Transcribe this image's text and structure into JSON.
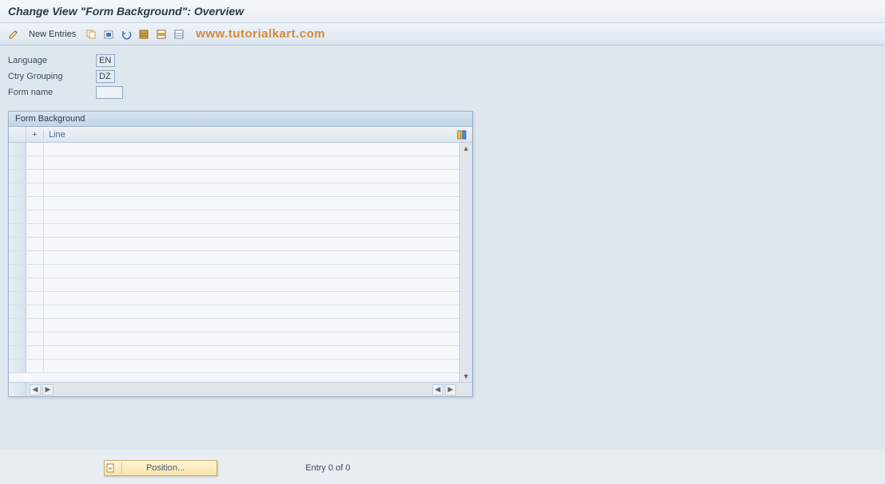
{
  "title": "Change View \"Form Background\": Overview",
  "toolbar": {
    "new_entries": "New Entries",
    "watermark": "www.tutorialkart.com"
  },
  "form": {
    "language_label": "Language",
    "language_value": "EN",
    "ctry_label": "Ctry Grouping",
    "ctry_value": "DZ",
    "formname_label": "Form name",
    "formname_value": ""
  },
  "table": {
    "title": "Form Background",
    "col_plus": "+",
    "col_line": "Line"
  },
  "footer": {
    "position_label": "Position...",
    "entry_label": "Entry 0 of 0"
  }
}
